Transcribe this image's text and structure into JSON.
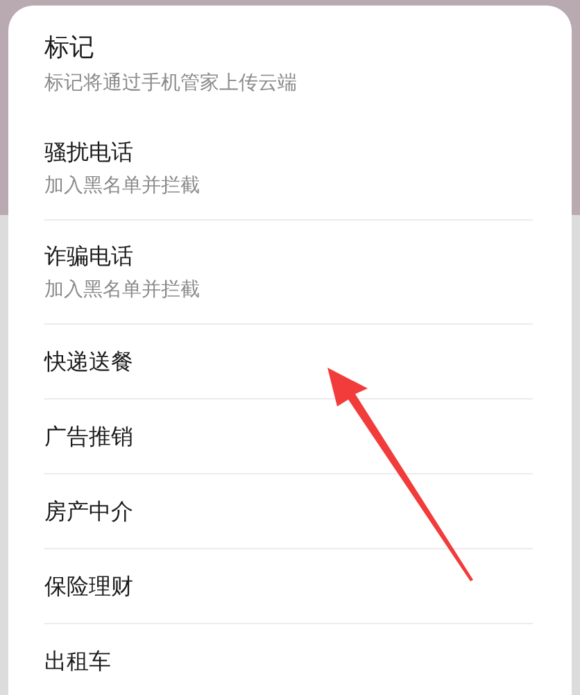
{
  "dialog": {
    "title": "标记",
    "subtitle": "标记将通过手机管家上传云端",
    "items": [
      {
        "label": "骚扰电话",
        "description": "加入黑名单并拦截"
      },
      {
        "label": "诈骗电话",
        "description": "加入黑名单并拦截"
      },
      {
        "label": "快递送餐"
      },
      {
        "label": "广告推销"
      },
      {
        "label": "房产中介"
      },
      {
        "label": "保险理财"
      },
      {
        "label": "出租车"
      }
    ]
  }
}
